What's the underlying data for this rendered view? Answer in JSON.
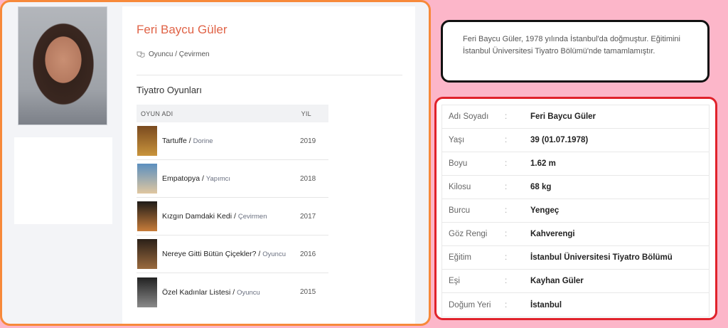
{
  "profile": {
    "name": "Feri Baycu Güler",
    "roles": "Oyuncu / Çevirmen",
    "section_title": "Tiyatro Oyunları",
    "table_headers": {
      "play": "OYUN ADI",
      "year": "YIL"
    },
    "plays": [
      {
        "title": "Tartuffe",
        "role": "Dorine",
        "year": "2019",
        "poster_colors": [
          "#7a4a1f",
          "#c9943c"
        ]
      },
      {
        "title": "Empatopya",
        "role": "Yapımcı",
        "year": "2018",
        "poster_colors": [
          "#5b8fbf",
          "#e0c7a0"
        ]
      },
      {
        "title": "Kızgın Damdaki Kedi",
        "role": "Çevirmen",
        "year": "2017",
        "poster_colors": [
          "#1e1b18",
          "#c87d3a"
        ]
      },
      {
        "title": "Nereye Gitti Bütün Çiçekler?",
        "role": "Oyuncu",
        "year": "2016",
        "poster_colors": [
          "#2b2018",
          "#9a6a3e"
        ]
      },
      {
        "title": "Özel Kadınlar Listesi",
        "role": "Oyuncu",
        "year": "2015",
        "poster_colors": [
          "#222222",
          "#8a8a8a"
        ]
      }
    ]
  },
  "bio": {
    "text": "Feri Baycu Güler, 1978 yılında İstanbul'da doğmuştur. Eğitimini İstanbul Üniversitesi Tiyatro Bölümü'nde tamamlamıştır."
  },
  "info": {
    "separator": ":",
    "rows": [
      {
        "label": "Adı Soyadı",
        "value": "Feri Baycu Güler"
      },
      {
        "label": "Yaşı",
        "value": "39 (01.07.1978)"
      },
      {
        "label": "Boyu",
        "value": "1.62 m"
      },
      {
        "label": "Kilosu",
        "value": "68 kg"
      },
      {
        "label": "Burcu",
        "value": "Yengeç"
      },
      {
        "label": "Göz Rengi",
        "value": "Kahverengi"
      },
      {
        "label": "Eğitim",
        "value": "İstanbul Üniversitesi Tiyatro Bölümü"
      },
      {
        "label": "Eşi",
        "value": "Kayhan Güler"
      },
      {
        "label": "Doğum Yeri",
        "value": "İstanbul"
      }
    ]
  },
  "colors": {
    "name_accent": "#e06347",
    "profile_border": "#f7893a",
    "info_border": "#e0222b",
    "bio_border": "#111111",
    "background": "#fcb6c9"
  }
}
